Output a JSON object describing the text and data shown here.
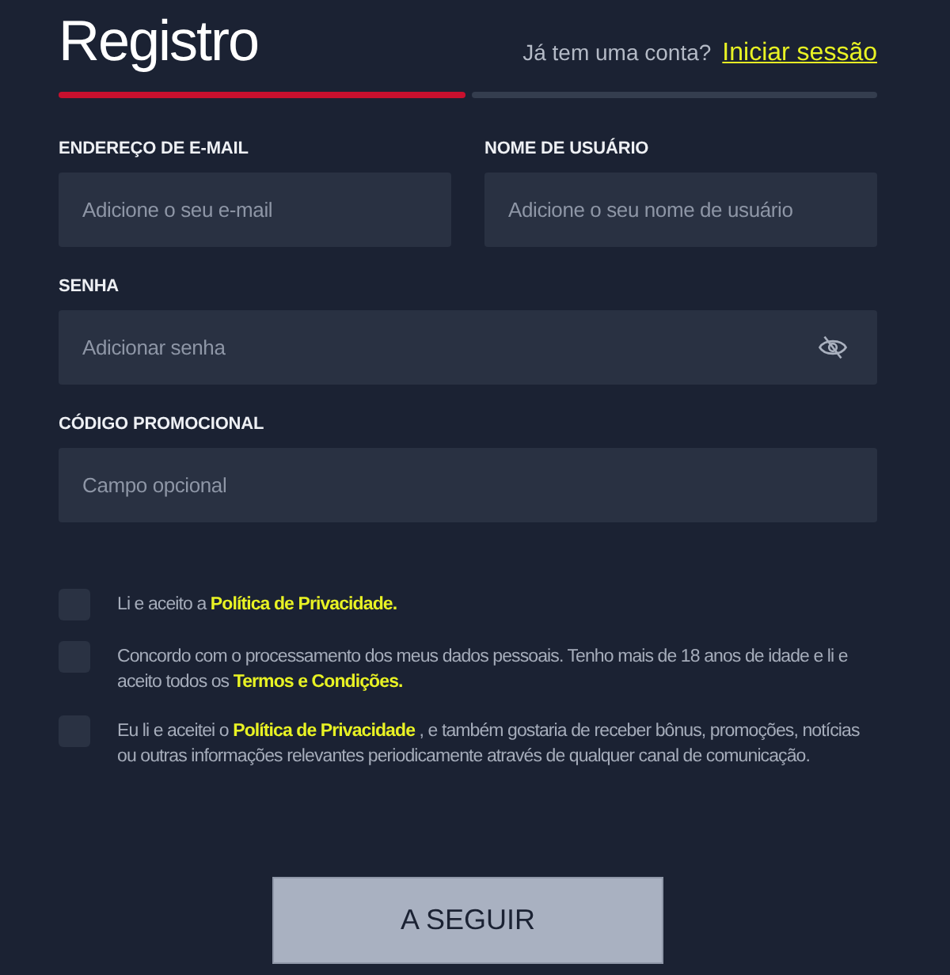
{
  "header": {
    "title": "Registro",
    "prompt": "Já tem uma conta?",
    "login_link": "Iniciar sessão"
  },
  "steps": [
    {
      "active": true
    },
    {
      "active": false
    }
  ],
  "field_rows": [
    [
      {
        "kind": "email",
        "label": "ENDEREÇO DE E-MAIL",
        "placeholder": "Adicione o seu e-mail"
      },
      {
        "kind": "text",
        "label": "NOME DE USUÁRIO",
        "placeholder": "Adicione o seu nome de usuário"
      }
    ],
    [
      {
        "kind": "password",
        "label": "SENHA",
        "placeholder": "Adicionar senha"
      }
    ],
    [
      {
        "kind": "text",
        "label": "CÓDIGO PROMOCIONAL",
        "placeholder": "Campo opcional"
      }
    ]
  ],
  "consents": [
    {
      "checked": false,
      "parts": [
        {
          "kind": "text",
          "text": "Li e aceito a "
        },
        {
          "kind": "link",
          "text": "Política de Privacidade."
        }
      ]
    },
    {
      "checked": false,
      "parts": [
        {
          "kind": "text",
          "text": "Concordo com o processamento dos meus dados pessoais. Tenho mais de 18 anos de idade e li e aceito todos os "
        },
        {
          "kind": "link",
          "text": "Termos e Condições."
        }
      ]
    },
    {
      "checked": false,
      "parts": [
        {
          "kind": "text",
          "text": "Eu li e aceitei o "
        },
        {
          "kind": "link",
          "text": "Política de Privacidade"
        },
        {
          "kind": "text",
          "text": " , e também gostaria de receber bônus, promoções, notícias ou outras informações relevantes periodicamente através de qualquer canal de comunicação."
        }
      ]
    }
  ],
  "submit": {
    "label": "A SEGUIR",
    "disabled": true
  }
}
